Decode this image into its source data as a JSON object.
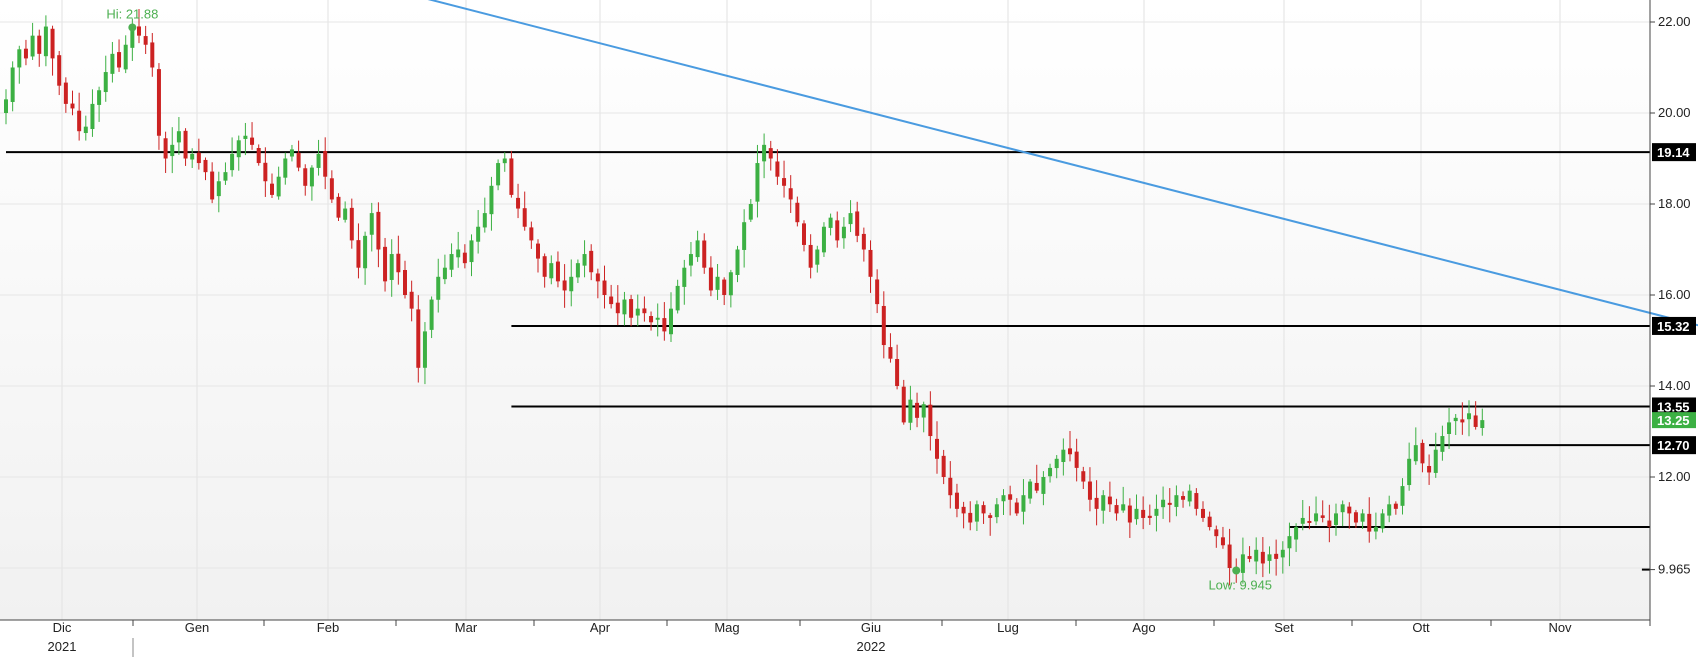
{
  "chart_data": {
    "type": "candlestick",
    "ylim": [
      8.4,
      22.5
    ],
    "y_ticks": [
      "22.00",
      "20.00",
      "18.00",
      "16.00",
      "14.00",
      "12.00",
      "9.965"
    ],
    "x_months": [
      "Dic",
      "Gen",
      "Feb",
      "Mar",
      "Apr",
      "Mag",
      "Giu",
      "Lug",
      "Ago",
      "Set",
      "Ott",
      "Nov"
    ],
    "x_years": [
      "2021",
      "2022"
    ],
    "grid": true,
    "colors": {
      "up": "#3cb043",
      "down": "#cc2222",
      "trendline": "#4a9be0",
      "level": "#000000",
      "hl_text": "#4caf50"
    },
    "high_label": "Hi: 21.88",
    "high_value": 21.88,
    "low_label": "Low: 9.945",
    "low_value": 9.945,
    "last_price": "13.25",
    "last_price_value": 13.25,
    "levels": [
      {
        "label": "19.14",
        "value": 19.14,
        "start_day": 0
      },
      {
        "label": "15.32",
        "value": 15.32,
        "start_day": 76
      },
      {
        "label": "13.55",
        "value": 13.55,
        "start_day": 76
      },
      {
        "label": "12.70",
        "value": 12.7,
        "start_day": 214
      },
      {
        "label": "",
        "value": 10.9,
        "start_day": 193
      },
      {
        "label": "9.965",
        "value": 9.965,
        "start_day": 246
      }
    ],
    "trendline": [
      {
        "day": -35,
        "value": 26.2
      },
      {
        "day": 310,
        "value": 13.25
      }
    ],
    "closes": [
      20.3,
      21.0,
      21.4,
      21.2,
      21.7,
      21.3,
      21.9,
      21.2,
      20.6,
      20.2,
      20.1,
      19.6,
      19.7,
      20.2,
      20.5,
      20.9,
      21.3,
      21.0,
      21.5,
      21.88,
      21.7,
      21.5,
      21.0,
      19.5,
      19.0,
      19.3,
      19.6,
      19.0,
      19.1,
      18.9,
      18.7,
      18.1,
      18.5,
      18.7,
      19.1,
      19.4,
      19.5,
      19.3,
      18.9,
      18.5,
      18.2,
      18.6,
      19.0,
      19.2,
      18.8,
      18.4,
      18.8,
      19.1,
      18.6,
      18.1,
      17.7,
      17.9,
      17.2,
      16.6,
      17.3,
      17.8,
      17.0,
      16.3,
      16.9,
      16.5,
      16.0,
      15.7,
      14.4,
      15.2,
      15.9,
      16.4,
      16.6,
      16.9,
      17.0,
      16.7,
      17.2,
      17.5,
      17.8,
      18.4,
      18.9,
      19.0,
      18.2,
      17.9,
      17.5,
      17.2,
      16.8,
      16.4,
      16.7,
      16.3,
      16.1,
      16.4,
      16.7,
      16.9,
      16.5,
      16.3,
      16.0,
      15.8,
      15.6,
      15.9,
      15.5,
      15.7,
      15.6,
      15.4,
      15.5,
      15.2,
      15.7,
      16.2,
      16.6,
      16.9,
      17.2,
      16.6,
      16.1,
      16.4,
      16.0,
      16.5,
      17.0,
      17.6,
      18.0,
      18.9,
      19.3,
      19.0,
      18.6,
      18.4,
      18.1,
      17.6,
      17.1,
      16.6,
      17.0,
      17.5,
      17.7,
      17.2,
      17.5,
      17.8,
      17.3,
      17.0,
      16.4,
      15.8,
      14.9,
      14.6,
      14.0,
      13.2,
      13.7,
      13.3,
      13.6,
      12.9,
      12.4,
      12.0,
      11.6,
      11.3,
      11.2,
      11.0,
      11.4,
      11.2,
      11.1,
      11.4,
      11.6,
      11.5,
      11.2,
      11.6,
      11.9,
      11.7,
      12.0,
      12.2,
      12.4,
      12.6,
      12.5,
      12.2,
      11.9,
      11.5,
      11.3,
      11.6,
      11.4,
      11.2,
      11.4,
      11.0,
      11.3,
      11.1,
      11.1,
      11.3,
      11.5,
      11.4,
      11.6,
      11.5,
      11.7,
      11.3,
      11.1,
      10.9,
      10.7,
      10.5,
      10.0,
      9.945,
      10.3,
      10.2,
      10.4,
      10.1,
      10.3,
      10.2,
      10.4,
      10.7,
      10.9,
      11.1,
      11.0,
      11.2,
      11.1,
      10.9,
      11.2,
      11.4,
      11.2,
      11.0,
      11.2,
      10.8,
      10.9,
      11.2,
      11.4,
      11.3,
      11.8,
      12.4,
      12.7,
      12.3,
      12.1,
      12.6,
      12.9,
      13.2,
      13.3,
      13.2,
      13.4,
      13.1,
      13.25
    ]
  }
}
